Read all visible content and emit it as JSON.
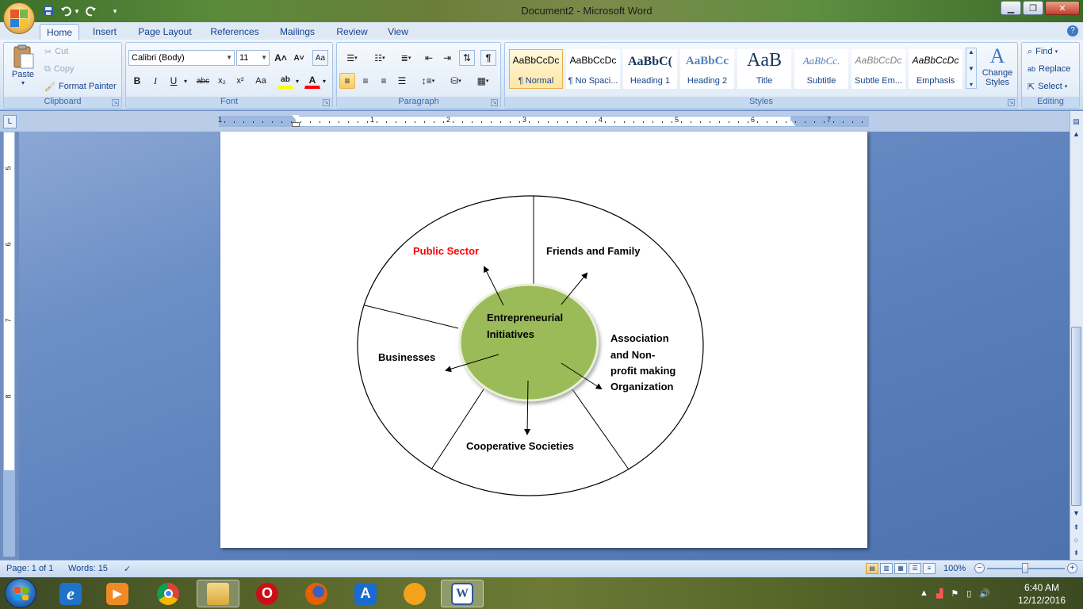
{
  "window": {
    "title": "Document2 - Microsoft Word",
    "controls": {
      "minimize": "▁",
      "maximize": "❐",
      "close": "✕"
    }
  },
  "quick_access": {
    "save_icon": "save-icon",
    "undo_icon": "undo-icon",
    "redo_icon": "redo-icon",
    "customize_icon": "chevron-down-icon"
  },
  "tabs": [
    {
      "label": "Home",
      "active": true
    },
    {
      "label": "Insert"
    },
    {
      "label": "Page Layout"
    },
    {
      "label": "References"
    },
    {
      "label": "Mailings"
    },
    {
      "label": "Review"
    },
    {
      "label": "View"
    }
  ],
  "clipboard": {
    "label": "Clipboard",
    "paste": "Paste",
    "cut": "Cut",
    "copy": "Copy",
    "format_painter": "Format Painter"
  },
  "font": {
    "label": "Font",
    "name": "Calibri (Body)",
    "size": "11",
    "grow": "A˄",
    "shrink": "A˅",
    "clear": "Aa",
    "bold": "B",
    "italic": "I",
    "underline": "U",
    "strike": "abc",
    "subscript": "x₂",
    "superscript": "x²",
    "change_case": "Aa",
    "highlight": "ab",
    "font_color": "A",
    "highlight_color": "#ffff00",
    "font_color_value": "#ff0000"
  },
  "paragraph": {
    "label": "Paragraph",
    "show_marks": "¶"
  },
  "styles": {
    "label": "Styles",
    "items": [
      {
        "preview": "AaBbCcDc",
        "name": "¶ Normal",
        "selected": true
      },
      {
        "preview": "AaBbCcDc",
        "name": "¶ No Spaci..."
      },
      {
        "preview": "AaBbC(",
        "name": "Heading 1"
      },
      {
        "preview": "AaBbCc",
        "name": "Heading 2"
      },
      {
        "preview": "AaB",
        "name": "Title"
      },
      {
        "preview": "AaBbCc.",
        "name": "Subtitle"
      },
      {
        "preview": "AaBbCcDc",
        "name": "Subtle Em..."
      },
      {
        "preview": "AaBbCcDc",
        "name": "Emphasis"
      }
    ],
    "change_styles": "Change Styles"
  },
  "editing": {
    "label": "Editing",
    "find": "Find",
    "replace": "Replace",
    "select": "Select"
  },
  "ruler": {
    "h_numbers": [
      "1",
      "1",
      "2",
      "3",
      "4",
      "5",
      "6",
      "7"
    ],
    "v_numbers": [
      "5",
      "6",
      "7",
      "8"
    ],
    "corner": "L"
  },
  "diagram": {
    "center": "Entrepreneurial Initiatives",
    "center_line1": "Entrepreneurial",
    "center_line2": "Initiatives",
    "center_color": "#9bbb59",
    "public_sector": "Public Sector",
    "public_sector_color": "#ff0000",
    "friends_family": "Friends and Family",
    "businesses": "Businesses",
    "association_lines": [
      "Association",
      "and Non-",
      "profit making",
      "Organization"
    ],
    "cooperative": "Cooperative Societies"
  },
  "statusbar": {
    "page": "Page: 1 of 1",
    "words": "Words: 15",
    "zoom": "100%"
  },
  "taskbar": {
    "apps": [
      {
        "name": "internet-explorer",
        "glyph": "e",
        "color": "#1e73c8"
      },
      {
        "name": "media-player",
        "glyph": "▶",
        "color": "#f08a24"
      },
      {
        "name": "chrome",
        "glyph": "",
        "color": "#2e9b3f"
      },
      {
        "name": "file-explorer",
        "glyph": "",
        "color": "#e9c25a"
      },
      {
        "name": "opera",
        "glyph": "O",
        "color": "#cc0f16"
      },
      {
        "name": "firefox",
        "glyph": "",
        "color": "#e66000"
      },
      {
        "name": "app-a",
        "glyph": "A",
        "color": "#1a6bd0"
      },
      {
        "name": "uc-browser",
        "glyph": "",
        "color": "#f2a21b"
      },
      {
        "name": "word",
        "glyph": "W",
        "color": "#2b5797",
        "active": true
      }
    ],
    "time": "6:40 AM",
    "date": "12/12/2016"
  }
}
